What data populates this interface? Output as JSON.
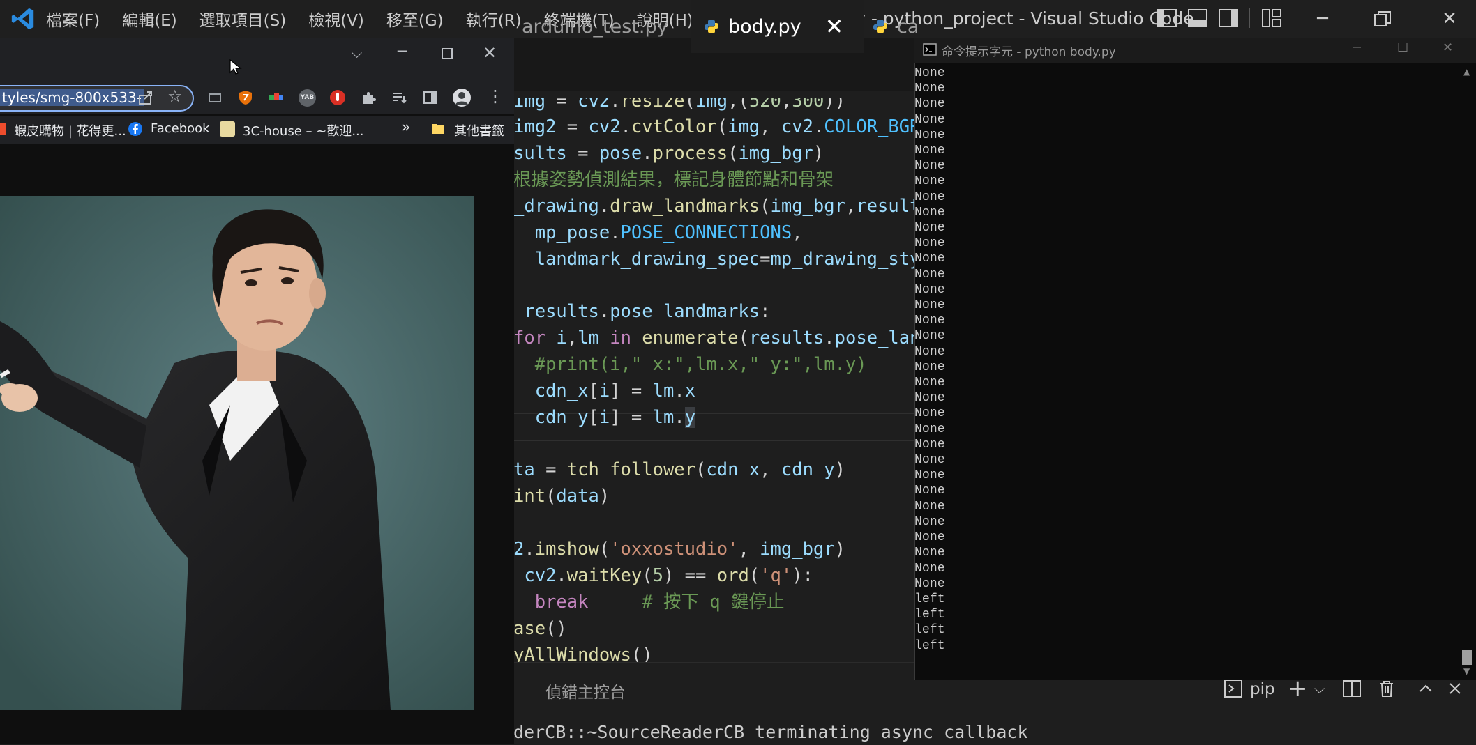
{
  "vscode": {
    "menu": [
      "檔案(F)",
      "編輯(E)",
      "選取項目(S)",
      "檢視(V)",
      "移至(G)",
      "執行(R)",
      "終端機(T)",
      "說明(H)"
    ],
    "title": "body.py - python_project - Visual Studio Code",
    "tabs": [
      {
        "label": "arduino_test.py"
      },
      {
        "label": "body.py",
        "close": "✕"
      },
      {
        "label": "ca"
      }
    ],
    "panel_tab": "偵錯主控台",
    "pip_label": "pip",
    "terminal_line": "derCB::~SourceReaderCB terminating async callback"
  },
  "browser": {
    "url": "tyles/smg-800x533-",
    "bookmarks": {
      "b1": "蝦皮購物 | 花得更...",
      "b2": "Facebook",
      "b3": "3C-house – ~歡迎...",
      "more": "»",
      "other": "其他書籤"
    },
    "ext_yab": "YAB"
  },
  "cmd": {
    "title": "命令提示字元 - python  body.py",
    "output": "None\nNone\nNone\nNone\nNone\nNone\nNone\nNone\nNone\nNone\nNone\nNone\nNone\nNone\nNone\nNone\nNone\nNone\nNone\nNone\nNone\nNone\nNone\nNone\nNone\nNone\nNone\nNone\nNone\nNone\nNone\nNone\nNone\nNone\nleft\nleft\nleft\nleft"
  },
  "colors": {
    "accent": "#0078d4",
    "python_blue": "#3d7ab5",
    "python_yellow": "#ffd43b"
  }
}
